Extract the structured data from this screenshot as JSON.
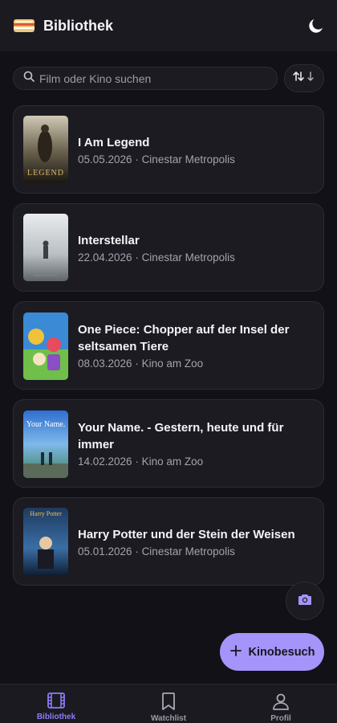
{
  "header": {
    "title": "Bibliothek",
    "logo_icon": "ticket-icon",
    "theme_icon": "moon-icon"
  },
  "search": {
    "placeholder": "Film oder Kino suchen",
    "value": ""
  },
  "sort": {
    "icon": "sort-arrows-icon"
  },
  "movies": [
    {
      "title": "I Am Legend",
      "subtitle": "05.05.2026 · Cinestar Metropolis",
      "poster_text": "LEGEND"
    },
    {
      "title": "Interstellar",
      "subtitle": "22.04.2026 · Cinestar Metropolis",
      "poster_text": ""
    },
    {
      "title": "One Piece: Chopper auf der Insel der seltsamen Tiere",
      "subtitle": "08.03.2026 · Kino am Zoo",
      "poster_text": ""
    },
    {
      "title": "Your Name. - Gestern, heute und für immer",
      "subtitle": "14.02.2026 · Kino am Zoo",
      "poster_text": "Your Name."
    },
    {
      "title": "Harry Potter und der Stein der Weisen",
      "subtitle": "05.01.2026 · Cinestar Metropolis",
      "poster_text": "Harry Potter"
    }
  ],
  "camera": {
    "icon": "camera-icon"
  },
  "fab": {
    "label": "Kinobesuch",
    "icon": "plus-icon"
  },
  "nav": {
    "items": [
      {
        "label": "Bibliothek",
        "icon": "film-icon",
        "active": true
      },
      {
        "label": "Watchlist",
        "icon": "bookmark-icon",
        "active": false
      },
      {
        "label": "Profil",
        "icon": "user-icon",
        "active": false
      }
    ]
  },
  "colors": {
    "accent": "#a594f9",
    "nav_active": "#8b7cf6",
    "background": "#121117",
    "card": "#1c1b22"
  }
}
